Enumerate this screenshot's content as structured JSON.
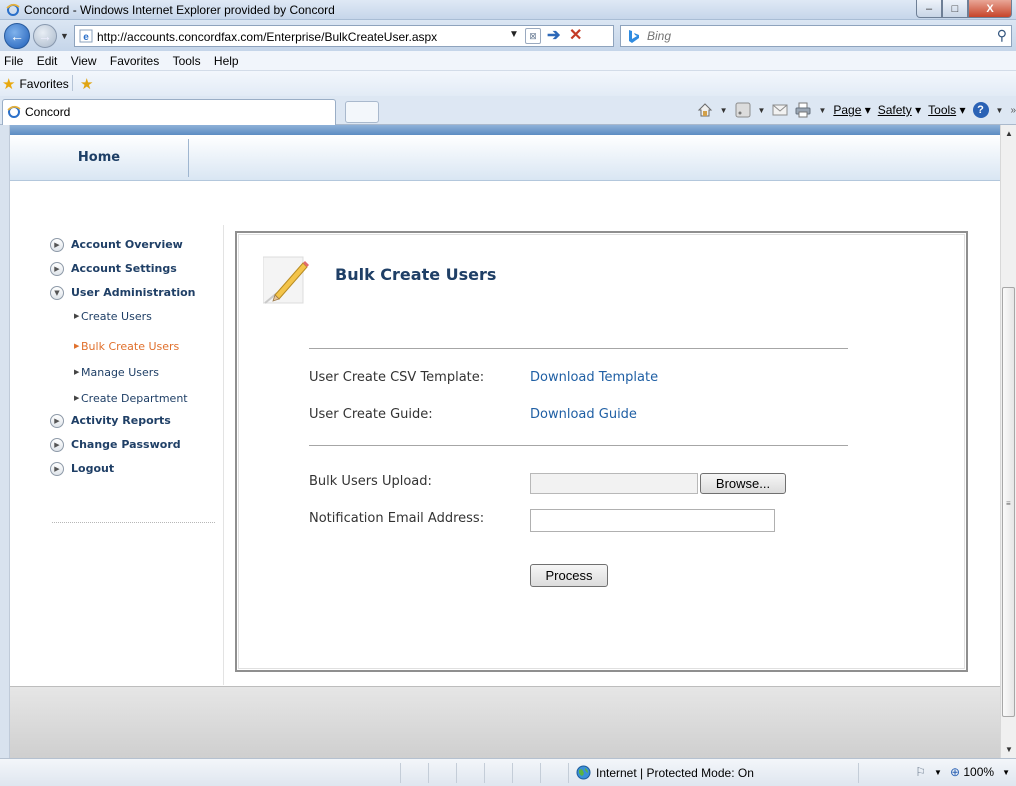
{
  "window": {
    "title": "Concord - Windows Internet Explorer provided by Concord",
    "controls": {
      "minimize": "–",
      "maximize": "□",
      "close": "X"
    }
  },
  "navigation": {
    "url": "http://accounts.concordfax.com/Enterprise/BulkCreateUser.aspx",
    "search_placeholder": "Bing"
  },
  "menubar": {
    "items": [
      "File",
      "Edit",
      "View",
      "Favorites",
      "Tools",
      "Help"
    ]
  },
  "favorites_bar": {
    "label": "Favorites"
  },
  "tabs": [
    {
      "label": "Concord"
    }
  ],
  "command_bar": {
    "page_label": "Page",
    "safety_label": "Safety",
    "tools_label": "Tools"
  },
  "site": {
    "home_label": "Home",
    "sidebar": {
      "items": [
        {
          "label": "Account Overview"
        },
        {
          "label": "Account Settings"
        },
        {
          "label": "User Administration",
          "expanded": true,
          "children": [
            {
              "label": "Create Users"
            },
            {
              "label": "Bulk Create Users",
              "active": true
            },
            {
              "label": "Manage Users"
            },
            {
              "label": "Create Department"
            }
          ]
        },
        {
          "label": "Activity Reports"
        },
        {
          "label": "Change Password"
        },
        {
          "label": "Logout"
        }
      ]
    },
    "panel": {
      "title": "Bulk Create Users",
      "template_label": "User Create CSV Template:",
      "template_link": "Download Template",
      "guide_label": "User Create Guide:",
      "guide_link": "Download Guide",
      "upload_label": "Bulk Users Upload:",
      "upload_value": "",
      "browse_button": "Browse...",
      "email_label": "Notification Email Address:",
      "email_value": "",
      "process_button": "Process"
    }
  },
  "statusbar": {
    "zone": "Internet | Protected Mode: On",
    "zoom": "100%"
  },
  "colors": {
    "link": "#1f5fa4",
    "active_nav": "#e0702c",
    "nav_text": "#1f3f66"
  }
}
